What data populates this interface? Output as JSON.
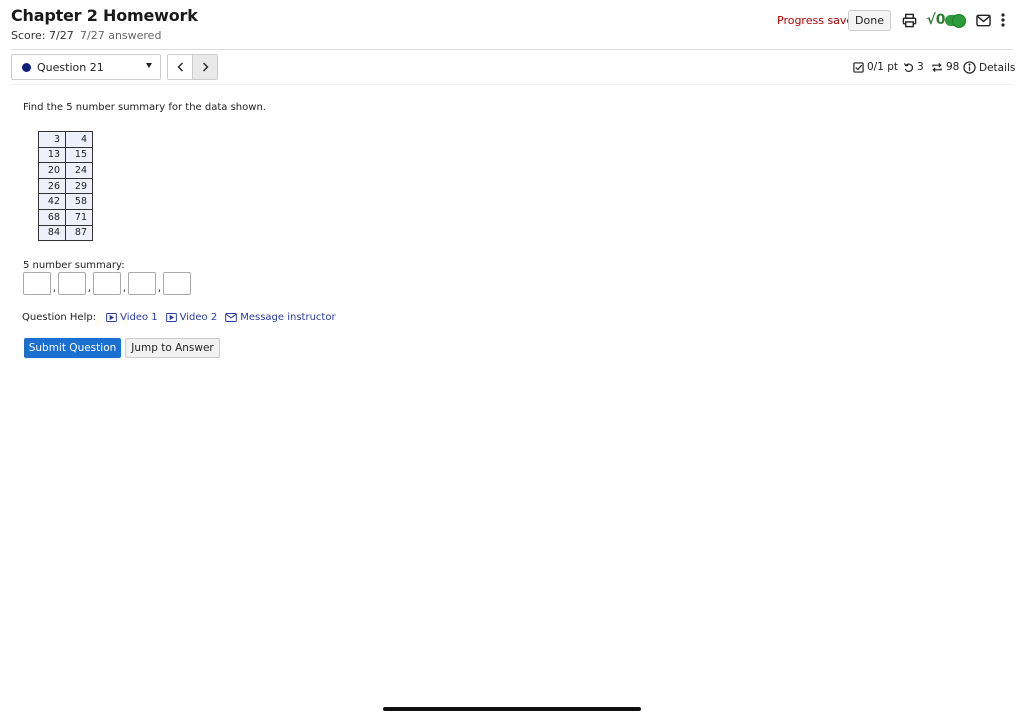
{
  "header": {
    "title": "Chapter 2 Homework",
    "score": "Score: 7/27",
    "answered": "7/27 answered",
    "progress_status": "Progress saved",
    "done_label": "Done",
    "icons": [
      "print-icon",
      "sqrt-icon",
      "toggle-switch",
      "mail-icon",
      "more-vertical-icon"
    ],
    "sqrt_text": "√0",
    "accent_color": "#2e9b3a",
    "saved_color": "#b00000"
  },
  "question_nav": {
    "selected": "Question 21",
    "meta": {
      "points": "0/1 pt",
      "retries": "3",
      "attempts": "98",
      "details_label": "Details"
    }
  },
  "question": {
    "prompt": "Find the 5 number summary for the data shown.",
    "table": [
      [
        "3",
        "4"
      ],
      [
        "13",
        "15"
      ],
      [
        "20",
        "24"
      ],
      [
        "26",
        "29"
      ],
      [
        "42",
        "58"
      ],
      [
        "68",
        "71"
      ],
      [
        "84",
        "87"
      ]
    ],
    "summary_label": "5 number summary:",
    "separator": ",",
    "answer_values": [
      "",
      "",
      "",
      "",
      ""
    ]
  },
  "help": {
    "label": "Question Help:",
    "links": [
      "Video 1",
      "Video 2",
      "Message instructor"
    ]
  },
  "actions": {
    "submit_label": "Submit Question",
    "jump_label": "Jump to Answer",
    "submit_color": "#1a6fd0"
  }
}
